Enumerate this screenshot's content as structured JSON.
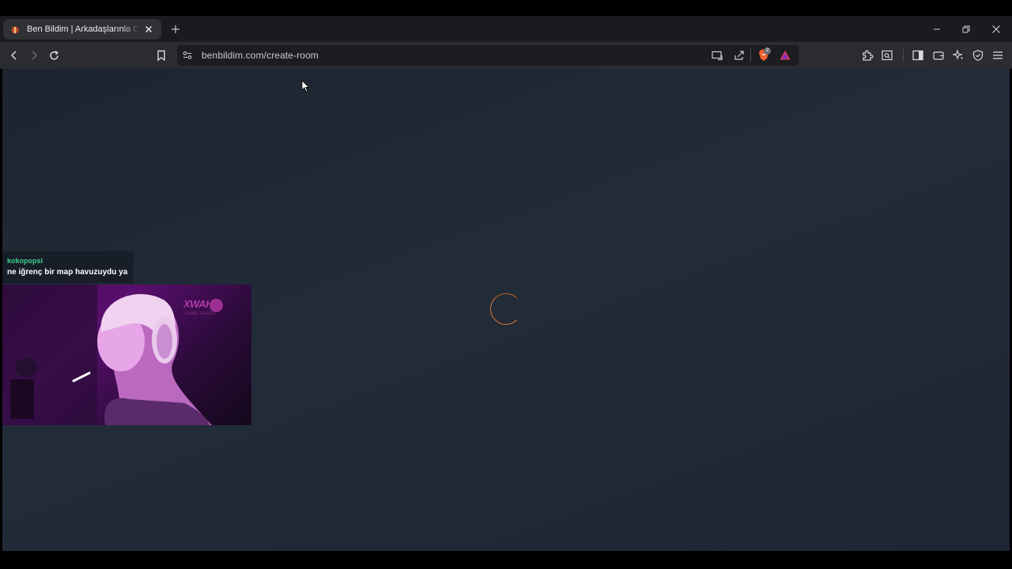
{
  "browser": {
    "tab": {
      "title": "Ben Bildim | Arkadaşlarınla Online",
      "favicon": "benbildim-favicon"
    },
    "address_bar": {
      "url": "benbildim.com/create-room"
    },
    "brave_shield_count": "2"
  },
  "page": {
    "state": "loading",
    "accent_color": "#e0772c",
    "background_color": "#1f2733"
  },
  "stream_overlay": {
    "chat": {
      "username": "kokopopsi",
      "username_color": "#3ccf8e",
      "message": "ne iğrenç bir map havuzuydu ya"
    },
    "webcam": {
      "logo_text": "XWAH",
      "logo_subtext": "GAME GEARS"
    }
  },
  "icons": [
    "back-icon",
    "forward-icon",
    "reload-icon",
    "bookmark-icon",
    "site-settings-icon",
    "cast-icon",
    "share-icon",
    "brave-shield-icon",
    "brave-rewards-icon",
    "extensions-icon",
    "reader-mode-icon",
    "sidebar-icon",
    "wallet-icon",
    "leo-ai-icon",
    "vpn-icon",
    "menu-icon",
    "minimize-icon",
    "restore-icon",
    "close-icon",
    "new-tab-icon",
    "tab-close-icon"
  ]
}
